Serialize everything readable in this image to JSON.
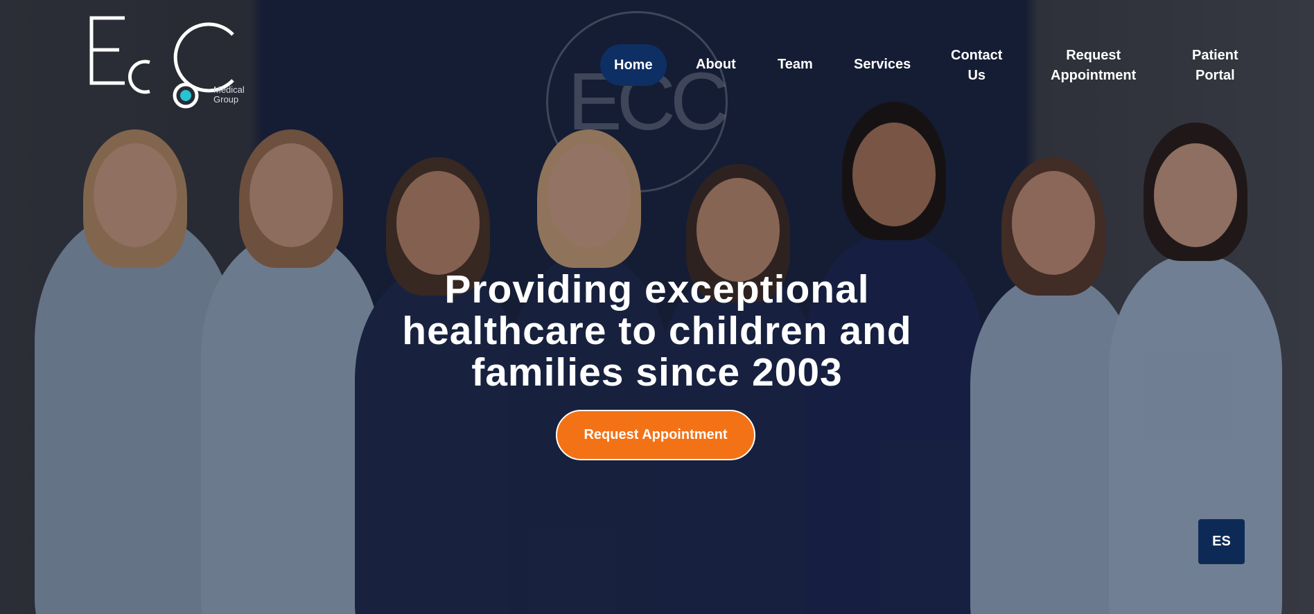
{
  "logo": {
    "mark": "ECC",
    "subtitle_line1": "Medical",
    "subtitle_line2": "Group"
  },
  "nav": {
    "items": [
      {
        "label": "Home",
        "active": true
      },
      {
        "label": "About"
      },
      {
        "label": "Team"
      },
      {
        "label": "Services"
      },
      {
        "label": "Contact\nUs"
      },
      {
        "label": "Request\nAppointment"
      },
      {
        "label": "Patient\nPortal"
      }
    ]
  },
  "hero": {
    "headline": "Providing exceptional healthcare to children and families since 2003",
    "cta_label": "Request Appointment"
  },
  "language_toggle": "ES",
  "colors": {
    "accent_orange": "#f47216",
    "navy": "#0e2f63",
    "logo_dot": "#27c4d6"
  }
}
